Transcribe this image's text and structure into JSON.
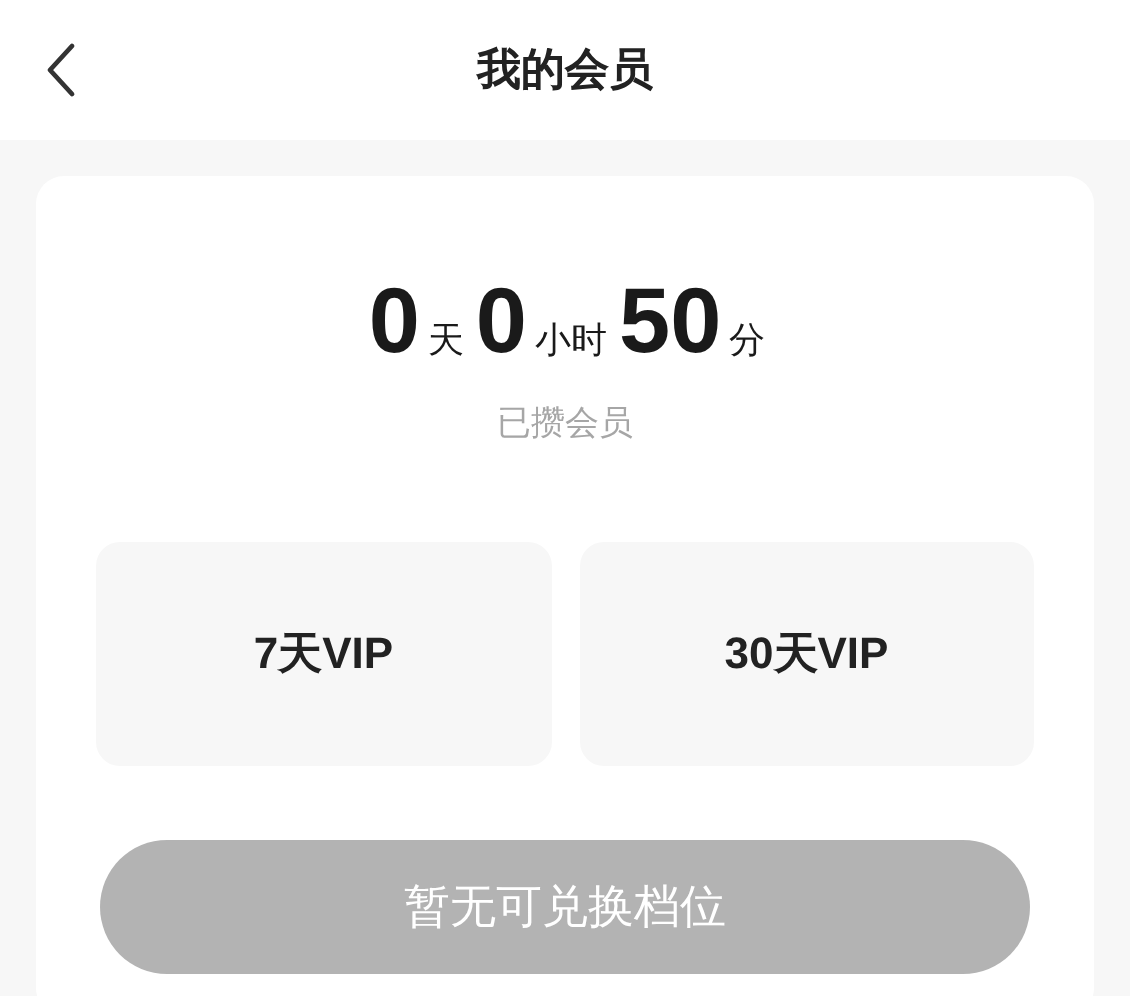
{
  "header": {
    "title": "我的会员"
  },
  "membership": {
    "time": [
      {
        "value": "0",
        "unit": "天"
      },
      {
        "value": "0",
        "unit": "小时"
      },
      {
        "value": "50",
        "unit": "分"
      }
    ],
    "caption": "已攒会员"
  },
  "options": [
    {
      "label": "7天VIP"
    },
    {
      "label": "30天VIP"
    }
  ],
  "redeem_button": {
    "label": "暂无可兑换档位",
    "disabled": true
  }
}
